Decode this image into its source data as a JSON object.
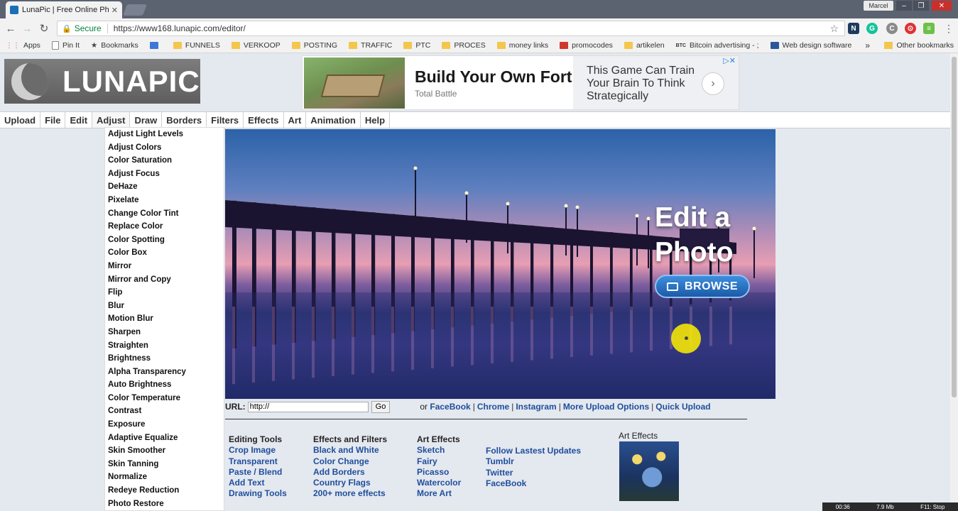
{
  "browser": {
    "tab_title": "LunaPic | Free Online Pho",
    "user_name": "Marcel",
    "secure_label": "Secure",
    "url": "https://www168.lunapic.com/editor/",
    "bookmarks": [
      {
        "label": "Apps",
        "icon": "apps-icon"
      },
      {
        "label": "Pin It",
        "icon": "page-icon"
      },
      {
        "label": "Bookmarks",
        "icon": "star-icon"
      },
      {
        "label": "",
        "icon": "blue-app-icon"
      },
      {
        "label": "FUNNELS",
        "icon": "folder-icon"
      },
      {
        "label": "VERKOOP",
        "icon": "folder-icon"
      },
      {
        "label": "POSTING",
        "icon": "folder-icon"
      },
      {
        "label": "TRAFFIC",
        "icon": "folder-icon"
      },
      {
        "label": "PTC",
        "icon": "folder-icon"
      },
      {
        "label": "PROCES",
        "icon": "folder-icon"
      },
      {
        "label": "money links",
        "icon": "folder-icon"
      },
      {
        "label": "promocodes",
        "icon": "red-site-icon"
      },
      {
        "label": "artikelen",
        "icon": "folder-icon"
      },
      {
        "label": "Bitcoin advertising - ;",
        "icon": "btc-icon"
      },
      {
        "label": "Web design software",
        "icon": "word-icon"
      }
    ],
    "bookmarks_more": "»",
    "other_bookmarks": "Other bookmarks"
  },
  "site": {
    "logo_text": "LUNAPIC",
    "ad": {
      "headline": "Build Your Own Fort",
      "source": "Total Battle",
      "teaser": "This Game Can Train Your Brain To Think Strategically",
      "adchoices": "▷✕"
    },
    "menu": [
      "Upload",
      "File",
      "Edit",
      "Adjust",
      "Draw",
      "Borders",
      "Filters",
      "Effects",
      "Art",
      "Animation",
      "Help"
    ],
    "adjust_menu": [
      "Adjust Light Levels",
      "Adjust Colors",
      "Color Saturation",
      "Adjust Focus",
      "DeHaze",
      "Pixelate",
      "Change Color Tint",
      "Replace Color",
      "Color Spotting",
      "Color Box",
      "Mirror",
      "Mirror and Copy",
      "Flip",
      "Blur",
      "Motion Blur",
      "Sharpen",
      "Straighten",
      "Brightness",
      "Alpha Transparency",
      "Auto Brightness",
      "Color Temperature",
      "Contrast",
      "Exposure",
      "Adaptive Equalize",
      "Skin Smoother",
      "Skin Tanning",
      "Normalize",
      "Redeye Reduction",
      "Photo Restore"
    ],
    "hero": {
      "title_line1": "Edit a",
      "title_line2": "Photo",
      "browse_label": "BROWSE"
    },
    "url_row": {
      "label": "URL:",
      "input_value": "http://",
      "go_label": "Go",
      "or_text": "or",
      "links": [
        "FaceBook",
        "Chrome",
        "Instagram",
        "More Upload Options",
        "Quick Upload"
      ]
    },
    "columns": {
      "editing": {
        "head": "Editing Tools",
        "links": [
          "Crop Image",
          "Transparent",
          "Paste / Blend",
          "Add Text",
          "Drawing Tools"
        ]
      },
      "effects": {
        "head": "Effects and Filters",
        "links": [
          "Black and White",
          "Color Change",
          "Add Borders",
          "Country Flags",
          "200+ more effects"
        ]
      },
      "art": {
        "head": "Art Effects",
        "links": [
          "Sketch",
          "Fairy",
          "Picasso",
          "Watercolor",
          "More Art"
        ]
      },
      "follow": {
        "head": "",
        "links": [
          "Follow Lastest Updates",
          "Tumblr",
          "Twitter",
          "FaceBook"
        ]
      }
    },
    "art_thumb_label": "Art Effects"
  },
  "recorder": {
    "time": "00:36",
    "size": "7.9 Mb",
    "hotkey": "F11: Stop"
  }
}
